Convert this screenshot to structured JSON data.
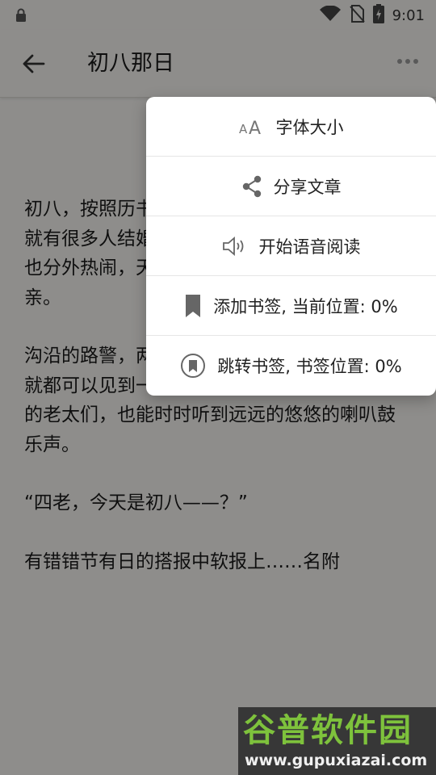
{
  "status": {
    "time": "9:01"
  },
  "toolbar": {
    "title": "初八那日"
  },
  "article": {
    "paragraphs": [
      "初八，按照历书上说是个吉日，又值星期六，就有很多人结婚。电影院换过新片子，大街上也分外热闹，天气又很好，于是大家都出来接亲。",
      "沟沿的路警，两点钟一换班，每一个值班警察就都可以见到一队音乐队过身。就是坐在家里的老太们，也能时时听到远远的悠悠的喇叭鼓乐声。",
      "“四老，今天是初八——？”",
      "有错错节有日的搭报中软报上……名附"
    ]
  },
  "menu": {
    "items": [
      {
        "label": "字体大小",
        "icon": "font-size-icon"
      },
      {
        "label": "分享文章",
        "icon": "share-icon"
      },
      {
        "label": "开始语音阅读",
        "icon": "speaker-icon"
      },
      {
        "label": "添加书签, 当前位置: 0%",
        "icon": "bookmark-icon"
      },
      {
        "label": "跳转书签, 书签位置: 0%",
        "icon": "bookmark-circle-icon"
      }
    ]
  },
  "watermark": {
    "title": "谷普软件园",
    "url": "www.gupuxiazai.com"
  },
  "colors": {
    "accent": "#7ec23c",
    "background": "#f4f3f0",
    "menu_bg": "#ffffff"
  }
}
